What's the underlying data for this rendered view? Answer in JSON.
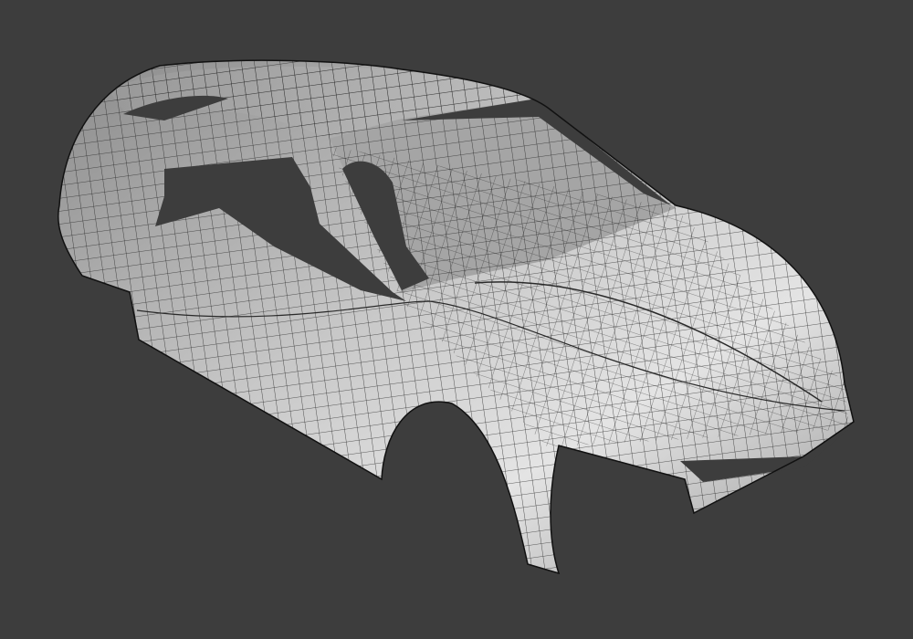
{
  "viewport": {
    "background_color": "#3d3d3d",
    "model": {
      "subject": "car-body-wireframe",
      "surface_color": "#b8b8b8",
      "surface_highlight": "#e6e6e6",
      "surface_shadow": "#7a7a7a",
      "wire_color": "#1e1e1e"
    }
  }
}
